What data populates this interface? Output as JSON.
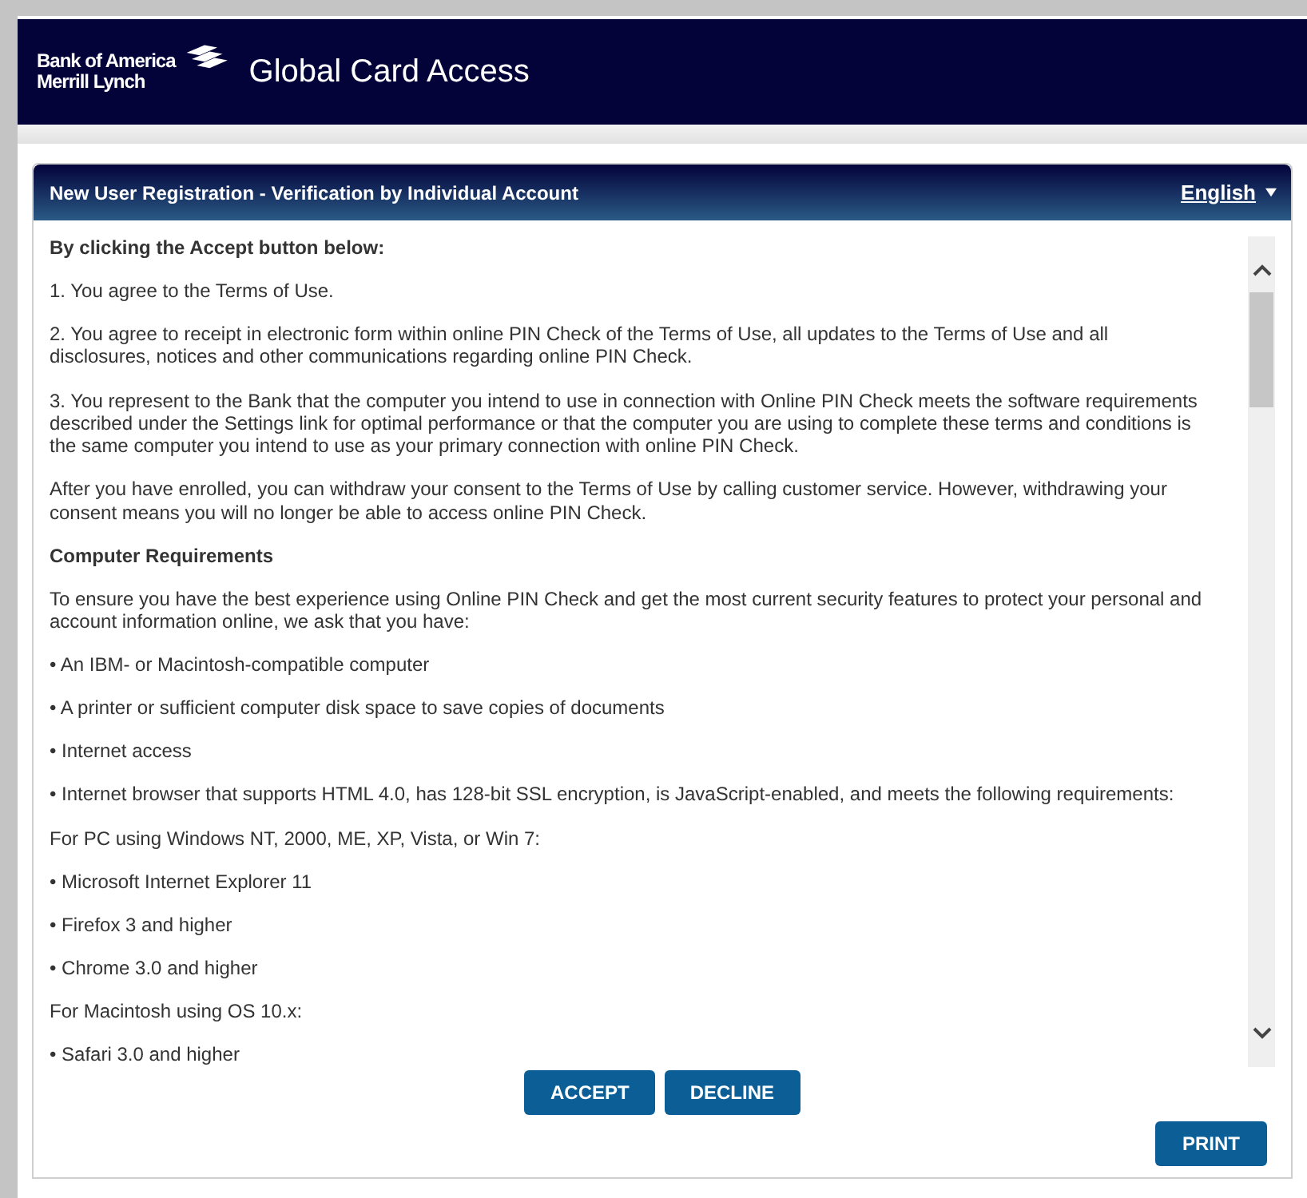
{
  "header": {
    "logo_line_1": "Bank of America",
    "logo_line_2": "Merrill Lynch",
    "title": "Global Card Access"
  },
  "panel": {
    "title": "New User Registration - Verification by Individual Account",
    "language": "English"
  },
  "paragraphs": [
    {
      "kind": "heading",
      "text": "By clicking the Accept button below:"
    },
    {
      "kind": "text",
      "text": "1. You agree to the Terms of Use."
    },
    {
      "kind": "text",
      "text": "2. You agree to receipt in electronic form within online PIN Check of the Terms of Use, all updates to the Terms of Use and all disclosures, notices and other communications regarding online PIN Check."
    },
    {
      "kind": "text",
      "text": "3. You represent to the Bank that the computer you intend to use in connection with Online PIN Check meets the software requirements described under the Settings link for optimal performance or that the computer you are using to complete these terms and conditions is the same computer you intend to use as your primary connection with online PIN Check."
    },
    {
      "kind": "text",
      "text": "After you have enrolled, you can withdraw your consent to the Terms of Use by calling customer service. However, withdrawing your consent means you will no longer be able to access online PIN Check."
    },
    {
      "kind": "heading",
      "text": "Computer Requirements"
    },
    {
      "kind": "text",
      "text": "To ensure you have the best experience using Online PIN Check and get the most current security features to protect your personal and account information online, we ask that you have:"
    },
    {
      "kind": "text",
      "text": "• An IBM- or Macintosh-compatible computer"
    },
    {
      "kind": "text",
      "text": "• A printer or sufficient computer disk space to save copies of documents"
    },
    {
      "kind": "text",
      "text": "• Internet access"
    },
    {
      "kind": "text",
      "text": "• Internet browser that supports HTML 4.0, has 128-bit SSL encryption, is JavaScript-enabled, and meets the following requirements:"
    },
    {
      "kind": "text",
      "text": "For PC using Windows NT, 2000, ME, XP, Vista, or Win 7:"
    },
    {
      "kind": "text",
      "text": "• Microsoft Internet Explorer 11"
    },
    {
      "kind": "text",
      "text": "• Firefox 3 and higher"
    },
    {
      "kind": "text",
      "text": "• Chrome 3.0 and higher"
    },
    {
      "kind": "text",
      "text": "For Macintosh using OS 10.x:"
    },
    {
      "kind": "text",
      "text": "• Safari 3.0 and higher"
    }
  ],
  "buttons": [
    "ACCEPT",
    "DECLINE"
  ],
  "print_button": "PRINT"
}
